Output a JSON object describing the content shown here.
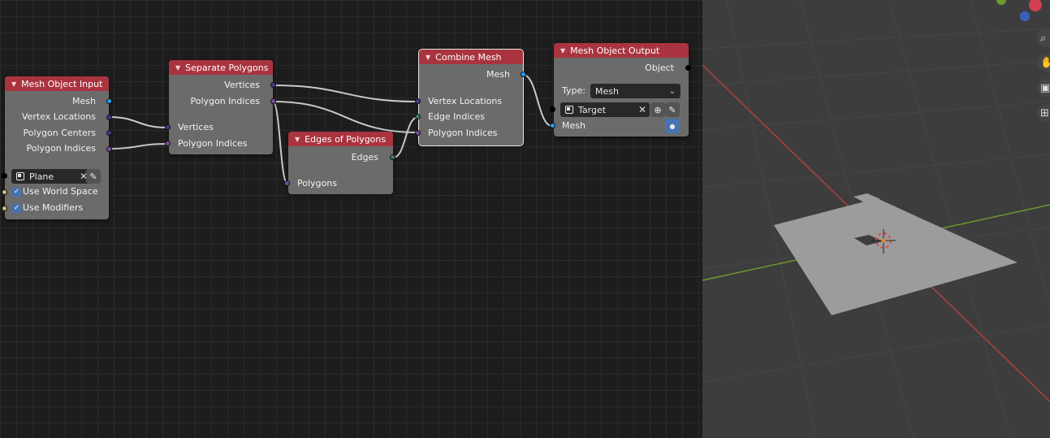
{
  "nodes": {
    "mesh_object_input": {
      "title": "Mesh Object Input",
      "outputs": [
        "Mesh",
        "Vertex Locations",
        "Polygon Centers",
        "Polygon Indices"
      ],
      "object_field": "Plane",
      "options": [
        {
          "label": "Use World Space",
          "checked": true
        },
        {
          "label": "Use Modifiers",
          "checked": true
        }
      ]
    },
    "separate_polygons": {
      "title": "Separate Polygons",
      "outputs": [
        "Vertices",
        "Polygon Indices"
      ],
      "inputs": [
        "Vertices",
        "Polygon Indices"
      ]
    },
    "edges_of_polygons": {
      "title": "Edges of Polygons",
      "outputs": [
        "Edges"
      ],
      "inputs": [
        "Polygons"
      ]
    },
    "combine_mesh": {
      "title": "Combine Mesh",
      "outputs": [
        "Mesh"
      ],
      "inputs": [
        "Vertex Locations",
        "Edge Indices",
        "Polygon Indices"
      ]
    },
    "mesh_object_output": {
      "title": "Mesh Object Output",
      "outputs": [
        "Object"
      ],
      "type_label": "Type:",
      "type_value": "Mesh",
      "object_field": "Target",
      "inputs": [
        "Mesh"
      ]
    }
  },
  "colors": {
    "node_header": "#a9343f",
    "node_body": "#6b6b6b",
    "socket_mesh": "#1ea0f0",
    "socket_vector": "#3a3c8e",
    "socket_polygon": "#7a4c9a",
    "socket_edge": "#3f7a6b",
    "link": "#c8c8c8",
    "editor_bg": "#1d1d1d",
    "viewport_bg": "#3d3d3d",
    "axis_x": "#b04040",
    "axis_y": "#6e9a2a"
  },
  "viewport": {
    "nav_icons": [
      "zoom-icon",
      "hand-icon",
      "camera-icon",
      "grid-icon"
    ]
  }
}
